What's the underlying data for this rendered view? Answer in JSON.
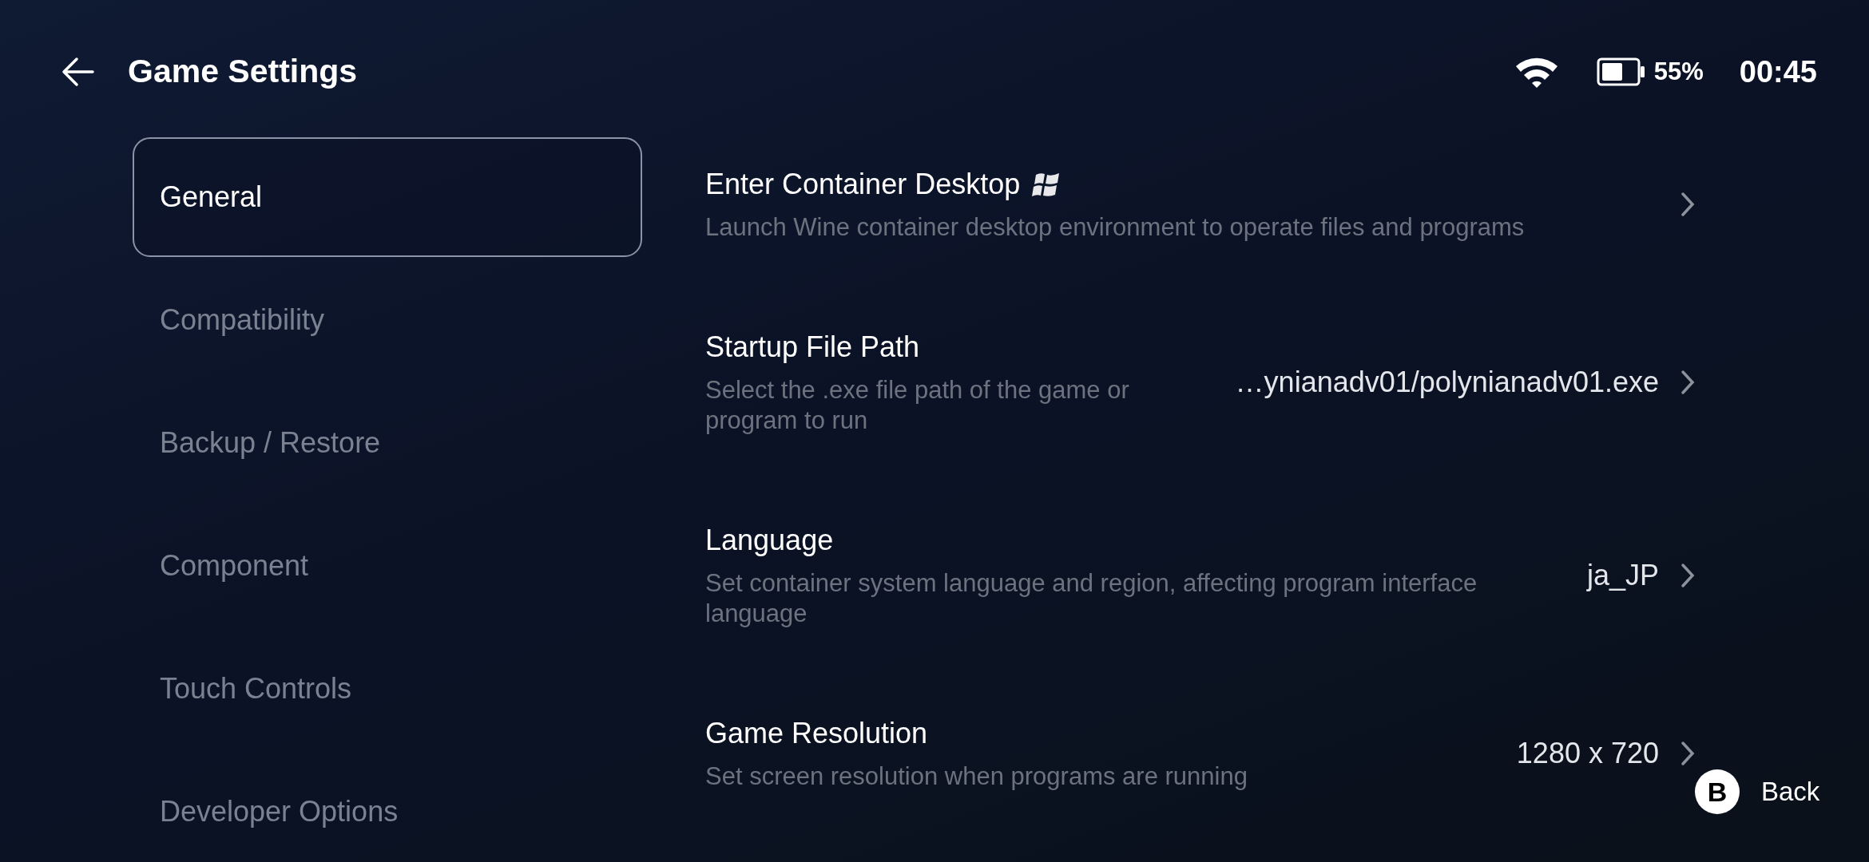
{
  "header": {
    "title": "Game Settings"
  },
  "status_bar": {
    "battery": "55%",
    "time": "00:45"
  },
  "sidebar": {
    "items": [
      {
        "label": "General",
        "selected": true
      },
      {
        "label": "Compatibility",
        "selected": false
      },
      {
        "label": "Backup / Restore",
        "selected": false
      },
      {
        "label": "Component",
        "selected": false
      },
      {
        "label": "Touch Controls",
        "selected": false
      },
      {
        "label": "Developer Options",
        "selected": false
      }
    ]
  },
  "settings": [
    {
      "kind": "launch",
      "title": "Enter Container Desktop",
      "description": "Launch Wine container desktop environment to operate files and programs"
    },
    {
      "kind": "option",
      "title": "Startup File Path",
      "description": "Select the .exe file path of the game or program to run",
      "value": "…ynianadv01/polynianadv01.exe"
    },
    {
      "kind": "option",
      "title": "Language",
      "description": "Set container system language and region, affecting program interface language",
      "value": "ja_JP"
    },
    {
      "kind": "option",
      "title": "Game Resolution",
      "description": "Set screen resolution when programs are running",
      "value": "1280 x 720"
    }
  ],
  "hint": {
    "key": "B",
    "label": "Back"
  }
}
